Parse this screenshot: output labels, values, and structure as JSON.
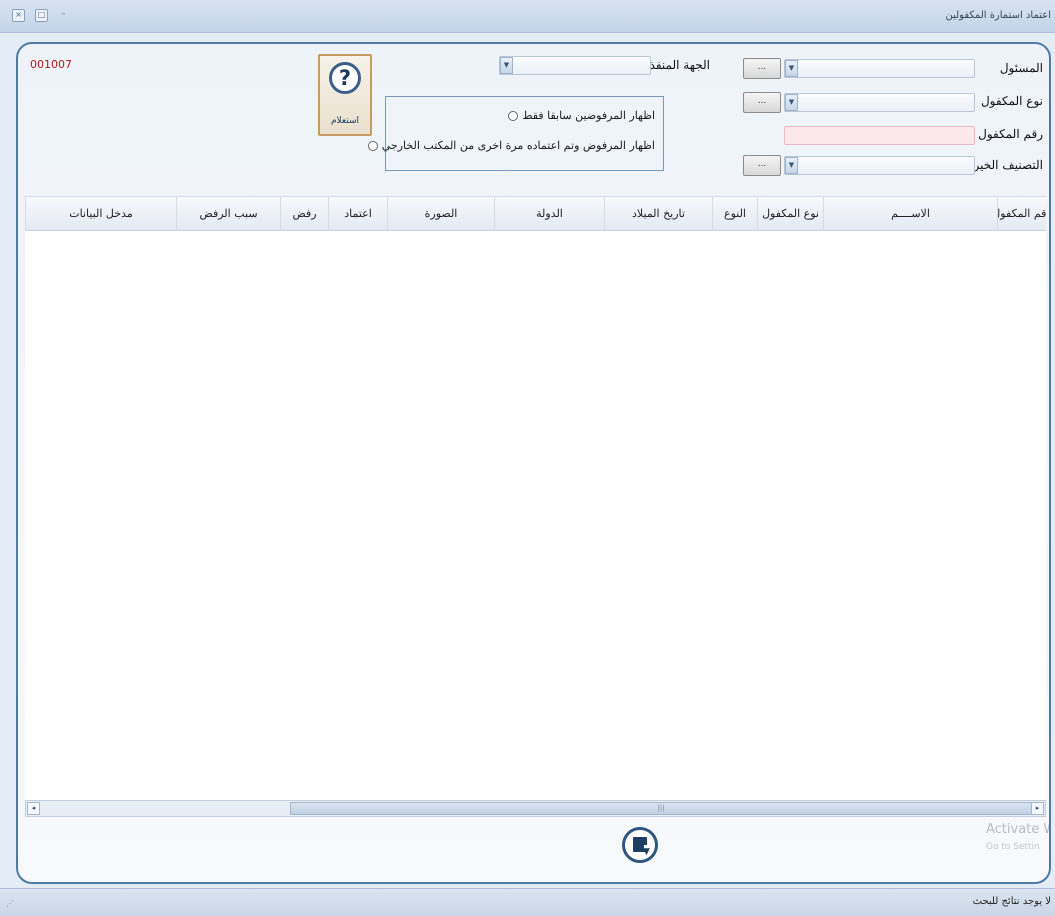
{
  "window": {
    "title": "اعتماد استمارة المكفولين",
    "close_glyph": "×",
    "maximize_glyph": "□",
    "minimize_glyph": "–"
  },
  "record_code": "001007",
  "form": {
    "sponsor_label": "المسئول",
    "type_label": "نوع المكفول",
    "number_label": "رقم المكفول",
    "category_label": "التصنيف الخيري",
    "executing_party_label": "الجهة المنفذة",
    "browse_button": "...",
    "dropdown_glyph": "▼"
  },
  "inquire_button": {
    "label": "استعلام",
    "icon_glyph": "?"
  },
  "options": {
    "previously_rejected": "اظهار المرفوضين سابقا فقط",
    "rejected_and_reapproved": "اظهار المرفوض وتم اعتماده مرة اخرى من المكتب الخارجي"
  },
  "grid": {
    "columns": [
      "رقم المكفول",
      "الاســــم",
      "نوع المكفول",
      "النوع",
      "تاريخ الميلاد",
      "الدولة",
      "الصورة",
      "اعتماد",
      "رفض",
      "سبب الرفض",
      "مدخل البيانات"
    ]
  },
  "scrollbar": {
    "left_glyph": "◂",
    "right_glyph": "▸",
    "thumb_glyph": "|||"
  },
  "watermark": {
    "title": "Activate W",
    "subtitle": "Go to Settin"
  },
  "status": {
    "text": "لا يوجد نتائج للبحث",
    "grip": "⋰"
  }
}
